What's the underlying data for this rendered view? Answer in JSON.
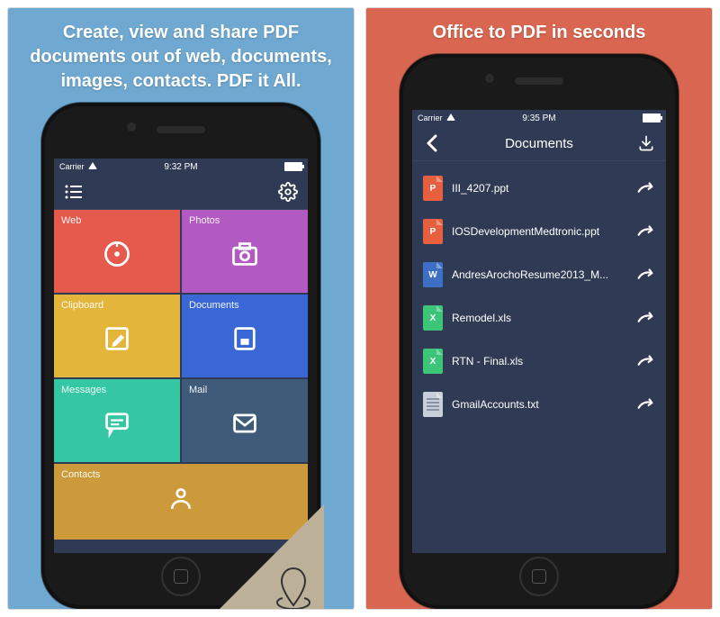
{
  "left": {
    "headline": "Create, view and share PDF documents out of web, documents, images, contacts. PDF it All.",
    "status": {
      "carrier": "Carrier",
      "time": "9:32 PM"
    },
    "tiles": [
      {
        "label": "Web",
        "color": "#e65a4e",
        "icon": "compass"
      },
      {
        "label": "Photos",
        "color": "#b25ac2",
        "icon": "camera"
      },
      {
        "label": "Clipboard",
        "color": "#e3b53a",
        "icon": "edit"
      },
      {
        "label": "Documents",
        "color": "#3a67d6",
        "icon": "doc"
      },
      {
        "label": "Messages",
        "color": "#35c6a3",
        "icon": "chat"
      },
      {
        "label": "Mail",
        "color": "#3f5b7a",
        "icon": "mail"
      }
    ],
    "contacts": {
      "label": "Contacts",
      "color": "#cc9a3a",
      "icon": "person"
    }
  },
  "right": {
    "headline": "Office to PDF in seconds",
    "status": {
      "carrier": "Carrier",
      "time": "9:35 PM"
    },
    "nav": {
      "title": "Documents"
    },
    "files": [
      {
        "name": "III_4207.ppt",
        "type": "ppt",
        "letter": "P"
      },
      {
        "name": "IOSDevelopmentMedtronic.ppt",
        "type": "ppt",
        "letter": "P"
      },
      {
        "name": "AndresArochoResume2013_M...",
        "type": "doc",
        "letter": "W"
      },
      {
        "name": "Remodel.xls",
        "type": "xls",
        "letter": "X"
      },
      {
        "name": "RTN - Final.xls",
        "type": "xls",
        "letter": "X"
      },
      {
        "name": "GmailAccounts.txt",
        "type": "txt",
        "letter": ""
      }
    ]
  }
}
